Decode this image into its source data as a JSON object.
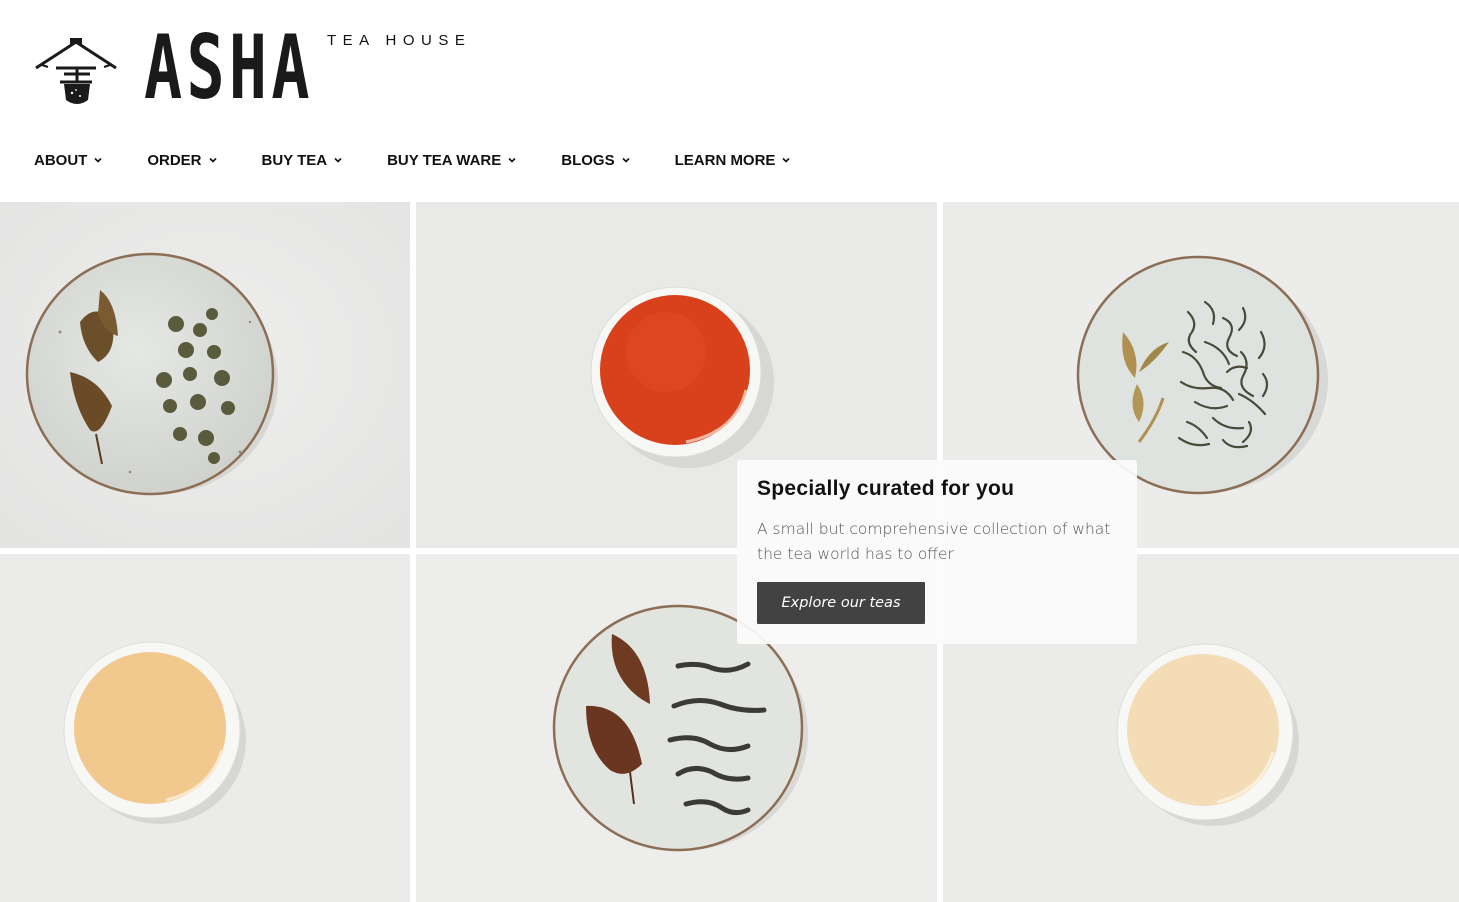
{
  "brand": {
    "name": "ASHA",
    "tagline": "TEA HOUSE",
    "logo_icon": "teapot-pavilion-icon"
  },
  "nav": {
    "items": [
      {
        "label": "ABOUT",
        "icon": "chevron-down-icon"
      },
      {
        "label": "ORDER",
        "icon": "chevron-down-icon"
      },
      {
        "label": "BUY TEA",
        "icon": "chevron-down-icon"
      },
      {
        "label": "BUY TEA WARE",
        "icon": "chevron-down-icon"
      },
      {
        "label": "BLOGS",
        "icon": "chevron-down-icon"
      },
      {
        "label": "LEARN MORE",
        "icon": "chevron-down-icon"
      }
    ]
  },
  "hero": {
    "tiles": [
      {
        "subject": "plate with oolong leaves and pearls"
      },
      {
        "subject": "cup of red tea"
      },
      {
        "subject": "plate with green tea leaves"
      },
      {
        "subject": "cup of light amber tea"
      },
      {
        "subject": "plate with dark twisted tea leaves"
      },
      {
        "subject": "cup of pale tea"
      }
    ],
    "card": {
      "title": "Specially curated for you",
      "text": "A small but comprehensive collection of what the tea world has to offer",
      "button_label": "Explore our teas"
    }
  },
  "colors": {
    "background": "#ffffff",
    "tile_background": "#e9e9e8",
    "button": "#424242",
    "red_tea": "#d9401c",
    "amber_tea": "#f1c98e",
    "pale_tea": "#f3dcb6"
  }
}
